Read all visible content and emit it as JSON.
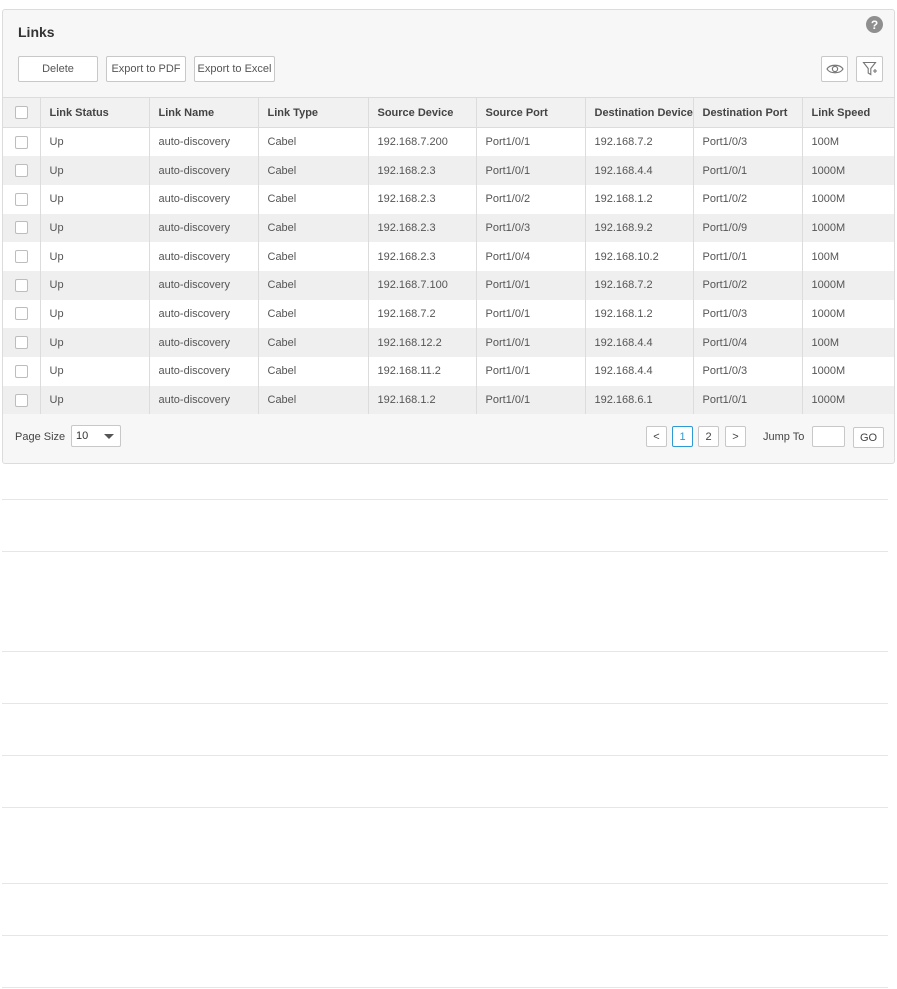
{
  "panel": {
    "title": "Links",
    "help_glyph": "?"
  },
  "toolbar": {
    "delete_label": "Delete",
    "export_pdf_label": "Export to PDF",
    "export_excel_label": "Export to Excel",
    "eye_icon": "eye-icon",
    "filter_icon": "filter-icon"
  },
  "table": {
    "columns": [
      "Link Status",
      "Link Name",
      "Link Type",
      "Source Device",
      "Source Port",
      "Destination Device",
      "Destination Port",
      "Link Speed"
    ],
    "rows": [
      [
        "Up",
        "auto-discovery",
        "Cabel",
        "192.168.7.200",
        "Port1/0/1",
        "192.168.7.2",
        "Port1/0/3",
        "100M"
      ],
      [
        "Up",
        "auto-discovery",
        "Cabel",
        "192.168.2.3",
        "Port1/0/1",
        "192.168.4.4",
        "Port1/0/1",
        "1000M"
      ],
      [
        "Up",
        "auto-discovery",
        "Cabel",
        "192.168.2.3",
        "Port1/0/2",
        "192.168.1.2",
        "Port1/0/2",
        "1000M"
      ],
      [
        "Up",
        "auto-discovery",
        "Cabel",
        "192.168.2.3",
        "Port1/0/3",
        "192.168.9.2",
        "Port1/0/9",
        "1000M"
      ],
      [
        "Up",
        "auto-discovery",
        "Cabel",
        "192.168.2.3",
        "Port1/0/4",
        "192.168.10.2",
        "Port1/0/1",
        "100M"
      ],
      [
        "Up",
        "auto-discovery",
        "Cabel",
        "192.168.7.100",
        "Port1/0/1",
        "192.168.7.2",
        "Port1/0/2",
        "1000M"
      ],
      [
        "Up",
        "auto-discovery",
        "Cabel",
        "192.168.7.2",
        "Port1/0/1",
        "192.168.1.2",
        "Port1/0/3",
        "1000M"
      ],
      [
        "Up",
        "auto-discovery",
        "Cabel",
        "192.168.12.2",
        "Port1/0/1",
        "192.168.4.4",
        "Port1/0/4",
        "100M"
      ],
      [
        "Up",
        "auto-discovery",
        "Cabel",
        "192.168.11.2",
        "Port1/0/1",
        "192.168.4.4",
        "Port1/0/3",
        "1000M"
      ],
      [
        "Up",
        "auto-discovery",
        "Cabel",
        "192.168.1.2",
        "Port1/0/1",
        "192.168.6.1",
        "Port1/0/1",
        "1000M"
      ]
    ]
  },
  "footer": {
    "page_size_label": "Page Size",
    "page_size_value": "10",
    "prev_label": "<",
    "pages": [
      "1",
      "2"
    ],
    "next_label": ">",
    "jump_to_label": "Jump To",
    "jump_value": "",
    "go_label": "GO"
  },
  "colors": {
    "accent": "#2d9ad5",
    "header_bg": "#f1f1f1",
    "row_alt_bg": "#efefef"
  }
}
